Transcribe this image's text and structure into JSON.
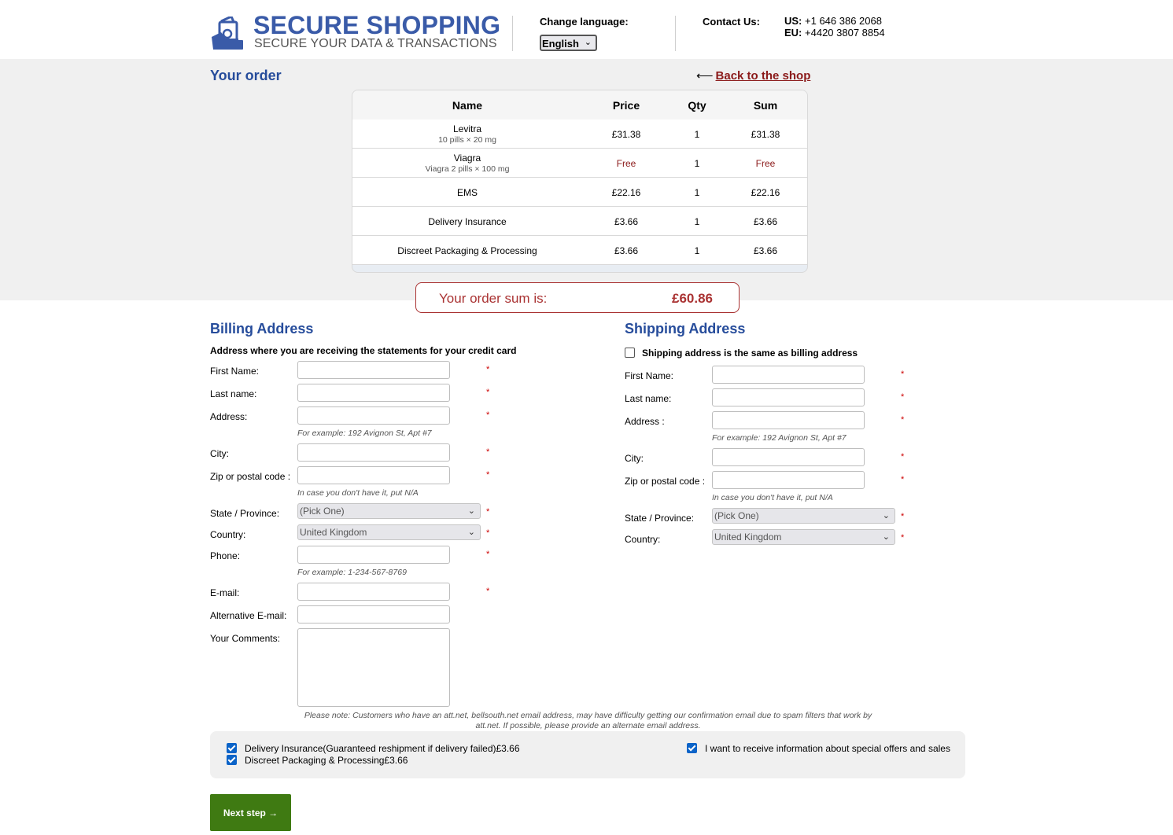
{
  "header": {
    "logo_title": "SECURE SHOPPING",
    "logo_subtitle": "SECURE YOUR DATA & TRANSACTIONS",
    "change_language_label": "Change language:",
    "language_selected": "English",
    "contact_label": "Contact Us:",
    "phones": [
      {
        "region": "US:",
        "number": "+1 646 386 2068"
      },
      {
        "region": "EU:",
        "number": "+4420 3807 8854"
      }
    ]
  },
  "order": {
    "title": "Your order",
    "back_link": "Back to the shop",
    "columns": [
      "Name",
      "Price",
      "Qty",
      "Sum"
    ],
    "rows": [
      {
        "name": "Levitra",
        "sub": "10 pills × 20 mg",
        "price": "£31.38",
        "qty": "1",
        "sum": "£31.38"
      },
      {
        "name": "Viagra",
        "sub": "Viagra 2 pills × 100 mg",
        "price": "Free",
        "qty": "1",
        "sum": "Free"
      },
      {
        "name": "EMS",
        "sub": "",
        "price": "£22.16",
        "qty": "1",
        "sum": "£22.16"
      },
      {
        "name": "Delivery Insurance",
        "sub": "",
        "price": "£3.66",
        "qty": "1",
        "sum": "£3.66"
      },
      {
        "name": "Discreet Packaging & Processing",
        "sub": "",
        "price": "£3.66",
        "qty": "1",
        "sum": "£3.66"
      }
    ],
    "sum_label": "Your order sum is:",
    "sum_value": "£60.86"
  },
  "billing": {
    "title": "Billing Address",
    "note": "Address where you are receiving the statements for your credit card",
    "first_name_label": "First Name:",
    "last_name_label": "Last name:",
    "address_label": "Address:",
    "address_hint": "For example: 192 Avignon St, Apt #7",
    "city_label": "City:",
    "zip_label": "Zip or postal code :",
    "zip_hint": "In case you don't have it, put N/A",
    "state_label": "State / Province:",
    "state_value": "(Pick One)",
    "country_label": "Country:",
    "country_value": "United Kingdom",
    "phone_label": "Phone:",
    "phone_hint": "For example: 1-234-567-8769",
    "email_label": "E-mail:",
    "alt_email_label": "Alternative E-mail:",
    "comments_label": "Your Comments:",
    "required_mark": "*"
  },
  "shipping": {
    "title": "Shipping Address",
    "same_as_billing_label": "Shipping address is the same as billing address",
    "first_name_label": "First Name:",
    "last_name_label": "Last name:",
    "address_label": "Address :",
    "address_hint": "For example: 192 Avignon St, Apt #7",
    "city_label": "City:",
    "zip_label": "Zip or postal code :",
    "zip_hint": "In case you don't have it, put N/A",
    "state_label": "State / Province:",
    "state_value": "(Pick One)",
    "country_label": "Country:",
    "country_value": "United Kingdom"
  },
  "notice": "Please note: Customers who have an att.net, bellsouth.net email address, may have difficulty getting our confirmation email due to spam filters that work by att.net. If possible, please provide an alternate email address.",
  "options": {
    "delivery_insurance": "Delivery Insurance(Guaranteed reshipment if delivery failed)£3.66",
    "discreet_packaging": "Discreet Packaging & Processing£3.66",
    "special_offers": "I want to receive information about special offers and sales"
  },
  "next_button": "Next step →",
  "back_arrow": "⟵",
  "select_chevron": "⌄",
  "colors": {
    "brand_blue": "#264c9b",
    "accent_red": "#a33333",
    "button_green": "#3f7a12",
    "checkbox_blue": "#0b63c8"
  }
}
